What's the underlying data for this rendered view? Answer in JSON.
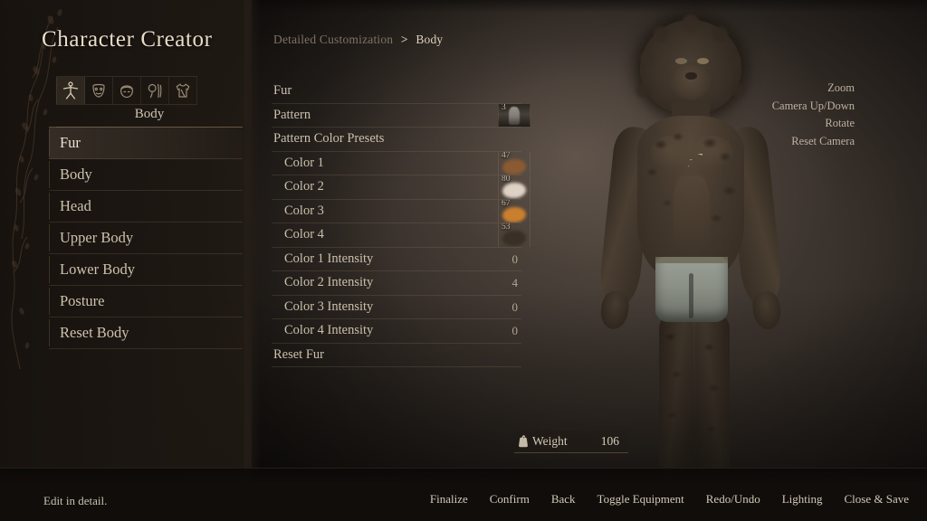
{
  "app": {
    "title": "Character Creator",
    "status_text": "Edit in detail."
  },
  "sidebar": {
    "category_label": "Body",
    "category_tabs": [
      {
        "icon": "body-figure-icon",
        "selected": true
      },
      {
        "icon": "face-icon",
        "selected": false
      },
      {
        "icon": "head-icon",
        "selected": false
      },
      {
        "icon": "hair-icon",
        "selected": false
      },
      {
        "icon": "clothing-icon",
        "selected": false
      }
    ],
    "items": [
      {
        "label": "Fur",
        "selected": true
      },
      {
        "label": "Body",
        "selected": false
      },
      {
        "label": "Head",
        "selected": false
      },
      {
        "label": "Upper Body",
        "selected": false
      },
      {
        "label": "Lower Body",
        "selected": false
      },
      {
        "label": "Posture",
        "selected": false
      },
      {
        "label": "Reset Body",
        "selected": false
      }
    ]
  },
  "breadcrumb": {
    "parent": "Detailed Customization",
    "separator": ">",
    "current": "Body"
  },
  "options": [
    {
      "label": "Fur",
      "kind": "header",
      "value": null
    },
    {
      "label": "Pattern",
      "kind": "thumb",
      "value": "3",
      "swatch_color": "#8b8680"
    },
    {
      "label": "Pattern Color Presets",
      "kind": "header",
      "value": null
    },
    {
      "label": "Color 1",
      "kind": "swatch",
      "value": "47",
      "swatch_color": "#8a5a33"
    },
    {
      "label": "Color 2",
      "kind": "swatch",
      "value": "80",
      "swatch_color": "#ddd2c4"
    },
    {
      "label": "Color 3",
      "kind": "swatch",
      "value": "67",
      "swatch_color": "#c97f2e"
    },
    {
      "label": "Color 4",
      "kind": "swatch",
      "value": "53",
      "swatch_color": "#3a2f26"
    },
    {
      "label": "Color 1 Intensity",
      "kind": "value",
      "value": "0"
    },
    {
      "label": "Color 2 Intensity",
      "kind": "value",
      "value": "4"
    },
    {
      "label": "Color 3 Intensity",
      "kind": "value",
      "value": "0"
    },
    {
      "label": "Color 4 Intensity",
      "kind": "value",
      "value": "0"
    },
    {
      "label": "Reset Fur",
      "kind": "header",
      "value": null
    }
  ],
  "camera_hints": [
    "Zoom",
    "Camera Up/Down",
    "Rotate",
    "Reset Camera"
  ],
  "weight": {
    "icon": "weight-scale-icon",
    "label": "Weight",
    "value": "106"
  },
  "bottom_actions": [
    "Finalize",
    "Confirm",
    "Back",
    "Toggle Equipment",
    "Redo/Undo",
    "Lighting",
    "Close & Save"
  ],
  "colors": {
    "panel_bg": "#1e1813",
    "text": "#cdc2af",
    "text_bright": "#e6dcc9",
    "text_dim": "#7e7263",
    "rule": "#96806433",
    "selected_row": "#74685850"
  }
}
